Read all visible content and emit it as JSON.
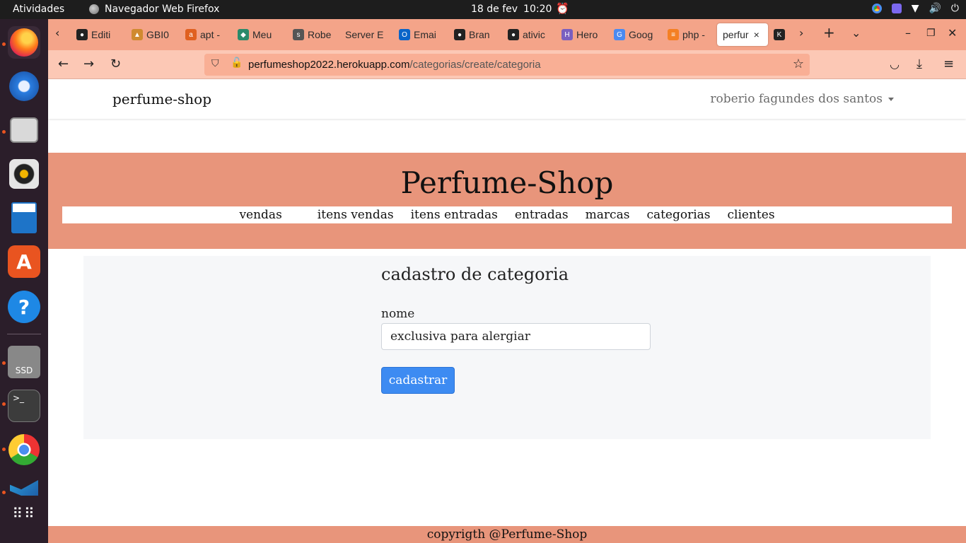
{
  "system": {
    "activities": "Atividades",
    "app_name": "Navegador Web Firefox",
    "date": "18 de fev",
    "time": "10:20"
  },
  "browser": {
    "tabs": [
      {
        "label": "Editi",
        "icon": "github-icon",
        "color": "#222222"
      },
      {
        "label": "GBI0",
        "icon": "book-icon",
        "color": "#d08a30"
      },
      {
        "label": "apt -",
        "icon": "ask-icon",
        "color": "#e06020"
      },
      {
        "label": "Meu",
        "icon": "network-icon",
        "color": "#2a8a6a"
      },
      {
        "label": "Robe",
        "icon": "suap-icon",
        "color": "#555555"
      },
      {
        "label": "Server E",
        "icon": "",
        "color": ""
      },
      {
        "label": "Emai",
        "icon": "outlook-icon",
        "color": "#0a64c8"
      },
      {
        "label": "Bran",
        "icon": "github-icon",
        "color": "#222222"
      },
      {
        "label": "ativic",
        "icon": "github-icon",
        "color": "#222222"
      },
      {
        "label": "Hero",
        "icon": "heroku-icon",
        "color": "#7a5fc0"
      },
      {
        "label": "Goog",
        "icon": "google-translate-icon",
        "color": "#4a8af0"
      },
      {
        "label": "php -",
        "icon": "stackoverflow-icon",
        "color": "#f48024"
      },
      {
        "label": "perfur",
        "icon": "",
        "color": ""
      }
    ],
    "url_host": "perfumeshop2022.herokuapp.com",
    "url_path": "/categorias/create/categoria"
  },
  "site": {
    "brand": "perfume-shop",
    "user": "roberio fagundes dos santos",
    "banner_title": "Perfume-Shop",
    "menu": [
      "vendas",
      "itens vendas",
      "itens entradas",
      "entradas",
      "marcas",
      "categorias",
      "clientes"
    ],
    "form": {
      "title": "cadastro de categoria",
      "name_label": "nome",
      "name_value": "exclusiva para alergiar",
      "submit_label": "cadastrar"
    },
    "footer": "copyrigth @Perfume-Shop"
  }
}
